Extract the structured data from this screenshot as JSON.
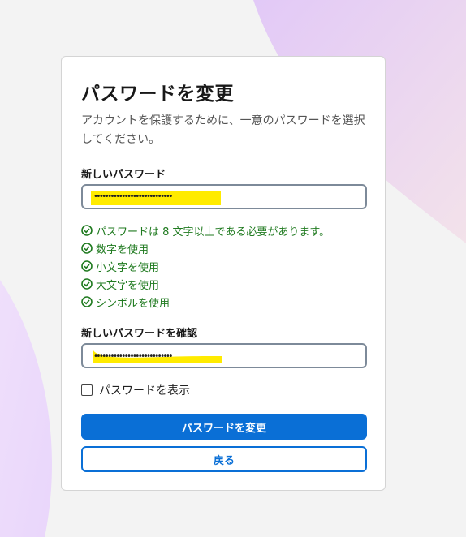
{
  "form": {
    "title": "パスワードを変更",
    "subtitle": "アカウントを保護するために、一意のパスワードを選択してください。",
    "new_password_label": "新しいパスワード",
    "new_password_value": "••••••••••••••••••••••••••••",
    "requirements": [
      {
        "text": "パスワードは 8 文字以上である必要があります。",
        "met": true
      },
      {
        "text": "数字を使用",
        "met": true
      },
      {
        "text": "小文字を使用",
        "met": true
      },
      {
        "text": "大文字を使用",
        "met": true
      },
      {
        "text": "シンボルを使用",
        "met": true
      }
    ],
    "confirm_password_label": "新しいパスワードを確認",
    "confirm_password_value": "••••••••••••••••••••••••••••",
    "show_password_label": "パスワードを表示",
    "show_password_checked": false,
    "submit_label": "パスワードを変更",
    "back_label": "戻る"
  },
  "colors": {
    "primary": "#0a6fd6",
    "success": "#1f7a1f",
    "highlight": "#ffeb00",
    "background": "#f3f3f3"
  },
  "icons": {
    "requirement": "check-circle-icon",
    "show_password": "checkbox"
  }
}
